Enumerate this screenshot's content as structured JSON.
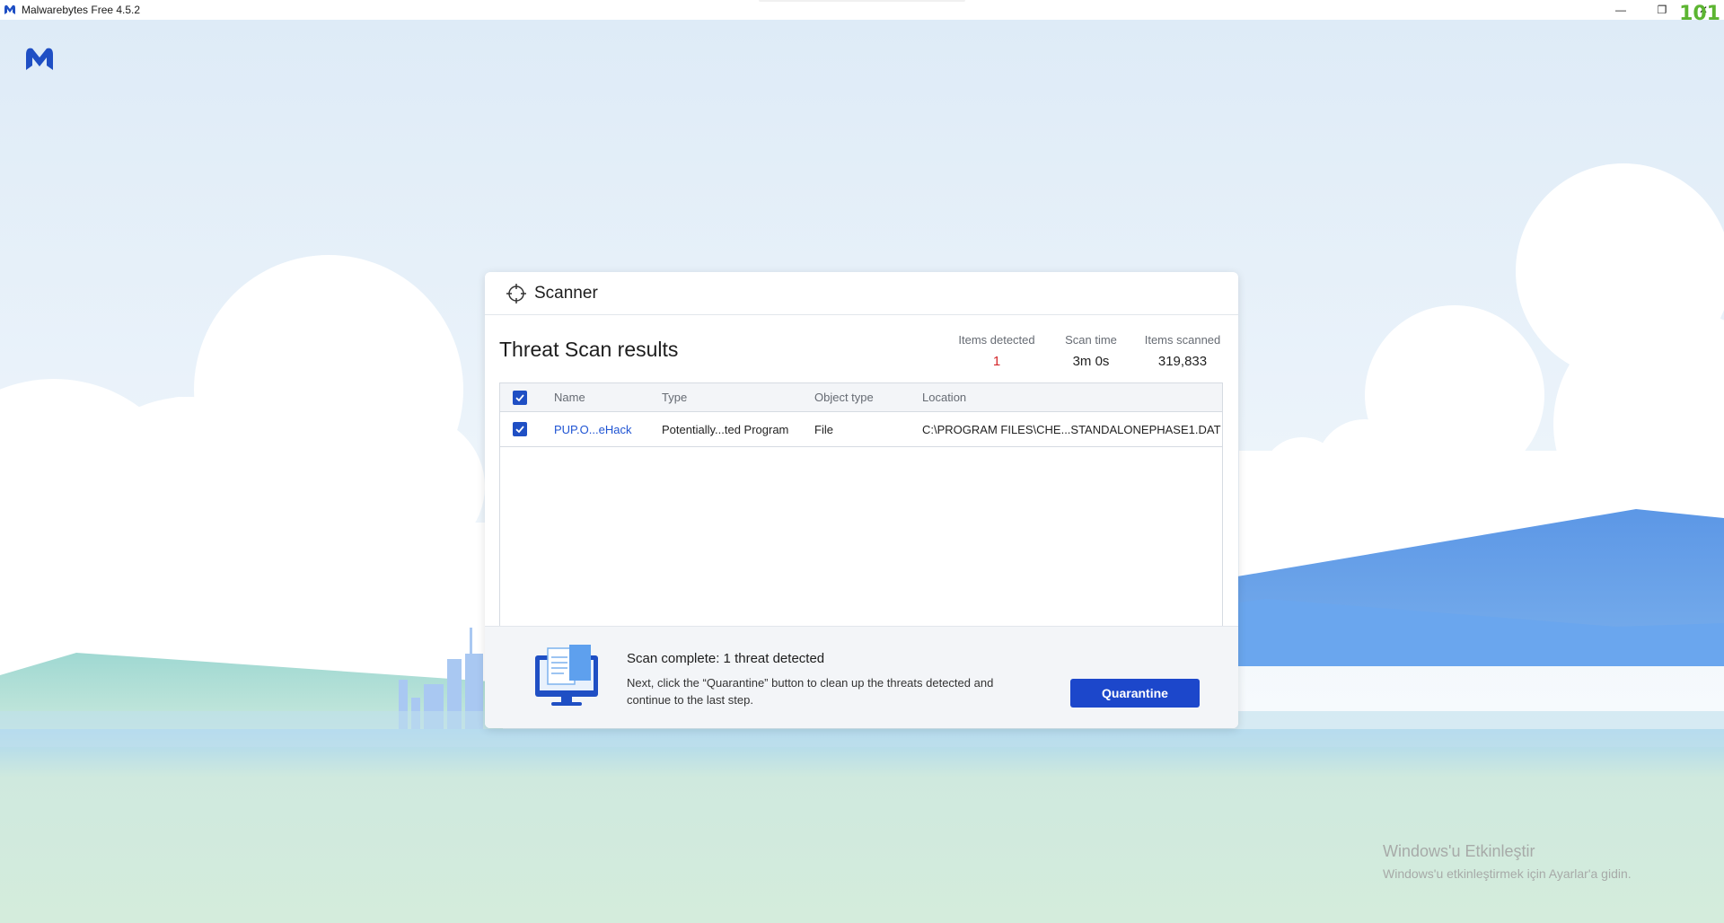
{
  "window": {
    "title": "Malwarebytes Free  4.5.2",
    "minimize_label": "—",
    "restore_label": "❐",
    "close_label": "✕",
    "overlay_counter": "101"
  },
  "scanner": {
    "header_title": "Scanner",
    "results_title": "Threat Scan results",
    "stats": {
      "items_detected_label": "Items detected",
      "items_detected_value": "1",
      "scan_time_label": "Scan time",
      "scan_time_value": "3m 0s",
      "items_scanned_label": "Items scanned",
      "items_scanned_value": "319,833"
    },
    "table": {
      "headers": [
        "Name",
        "Type",
        "Object type",
        "Location"
      ],
      "rows": [
        {
          "checked": true,
          "name": "PUP.O...eHack",
          "type": "Potentially...ted Program",
          "object_type": "File",
          "location": "C:\\PROGRAM FILES\\CHE...STANDALONEPHASE1.DAT"
        }
      ]
    },
    "footer": {
      "title": "Scan complete: 1 threat detected",
      "description": "Next, click the “Quarantine” button to clean up the threats detected and continue to the last step.",
      "quarantine_label": "Quarantine"
    }
  },
  "activation": {
    "title": "Windows'u Etkinleştir",
    "subtitle": "Windows'u etkinleştirmek için Ayarlar'a gidin."
  },
  "colors": {
    "accent": "#1c47cb",
    "detected_red": "#d4272b",
    "sky": "#e2eef8",
    "grass": "#d4ecdc",
    "hill_blue": "#5f9ae8"
  }
}
